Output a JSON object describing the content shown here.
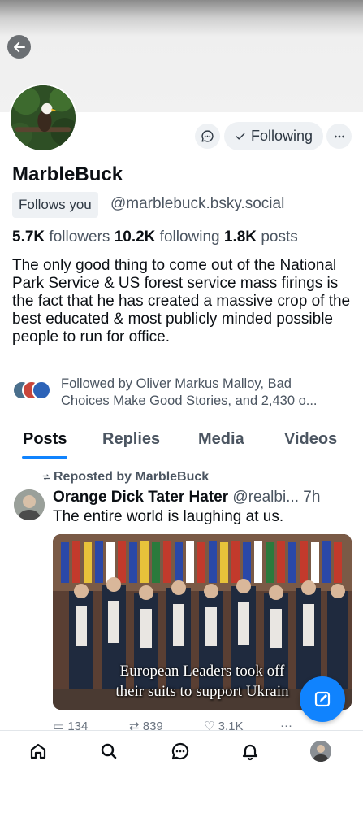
{
  "profile": {
    "display_name": "MarbleBuck",
    "follows_you_label": "Follows you",
    "handle": "@marblebuck.bsky.social",
    "following_button_label": "Following",
    "stats": {
      "followers_count": "5.7K",
      "followers_label": "followers",
      "following_count": "10.2K",
      "following_label": "following",
      "posts_count": "1.8K",
      "posts_label": "posts"
    },
    "bio": "The only good thing to come out of the National Park Service & US forest service mass firings is the fact that he has created a massive crop of the best educated & most publicly minded possible people to run for office.",
    "followed_by_line1": "Followed by Oliver Markus Malloy, Bad",
    "followed_by_line2": "Choices Make Good Stories, and 2,430 o..."
  },
  "tabs": [
    {
      "label": "Posts",
      "active": true
    },
    {
      "label": "Replies",
      "active": false
    },
    {
      "label": "Media",
      "active": false
    },
    {
      "label": "Videos",
      "active": false
    }
  ],
  "post": {
    "repost_label": "Reposted by MarbleBuck",
    "author": "Orange Dick Tater Hater",
    "handle": "@realbi...",
    "time": "7h",
    "text": "The entire world is laughing at us.",
    "image_caption_line1": "European Leaders took off",
    "image_caption_line2": "their suits to support Ukrain",
    "actions": {
      "replies": "134",
      "reposts": "839",
      "likes": "3.1K"
    }
  },
  "icons": {
    "back": "arrow-left-icon",
    "message": "chat-bubble-icon",
    "following_check": "check-icon",
    "more": "ellipsis-icon",
    "repost": "repost-icon",
    "compose": "compose-icon",
    "nav": [
      "home-icon",
      "search-icon",
      "chat-icon",
      "bell-icon",
      "profile-avatar"
    ]
  },
  "colors": {
    "accent": "#1083fe",
    "text_primary": "#0b0f14",
    "text_secondary": "#4b5561",
    "pill_bg": "#eef1f4"
  }
}
